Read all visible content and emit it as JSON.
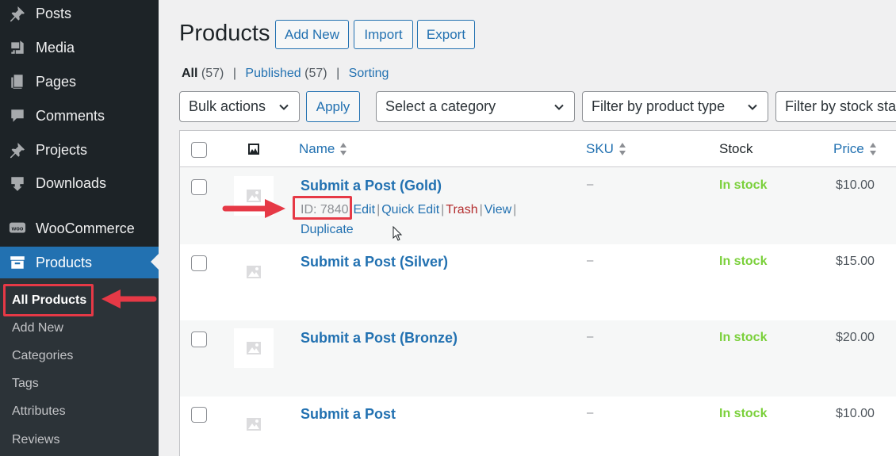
{
  "sidebar": {
    "items": [
      {
        "label": "Posts",
        "icon": "pin-icon"
      },
      {
        "label": "Media",
        "icon": "media-icon"
      },
      {
        "label": "Pages",
        "icon": "pages-icon"
      },
      {
        "label": "Comments",
        "icon": "comment-icon"
      },
      {
        "label": "Projects",
        "icon": "pin-icon"
      },
      {
        "label": "Downloads",
        "icon": "download-icon"
      },
      {
        "label": "WooCommerce",
        "icon": "woo-icon"
      },
      {
        "label": "Products",
        "icon": "archive-icon",
        "current": true
      }
    ],
    "submenu": [
      "All Products",
      "Add New",
      "Categories",
      "Tags",
      "Attributes",
      "Reviews"
    ],
    "woo_badge": "woo"
  },
  "header": {
    "title": "Products",
    "buttons": [
      "Add New",
      "Import",
      "Export"
    ]
  },
  "views": {
    "all_label": "All",
    "all_count": "(57)",
    "published_label": "Published",
    "published_count": "(57)",
    "sorting_label": "Sorting",
    "separator": "|"
  },
  "filters": {
    "bulk_actions": "Bulk actions",
    "apply": "Apply",
    "category": "Select a category",
    "product_type": "Filter by product type",
    "stock_status": "Filter by stock status"
  },
  "table": {
    "columns": {
      "name": "Name",
      "sku": "SKU",
      "stock": "Stock",
      "price": "Price"
    },
    "rows": [
      {
        "name": "Submit a Post (Gold)",
        "sku": "–",
        "stock": "In stock",
        "price": "$10.00"
      },
      {
        "name": "Submit a Post (Silver)",
        "sku": "–",
        "stock": "In stock",
        "price": "$15.00"
      },
      {
        "name": "Submit a Post (Bronze)",
        "sku": "–",
        "stock": "In stock",
        "price": "$20.00"
      },
      {
        "name": "Submit a Post",
        "sku": "–",
        "stock": "In stock",
        "price": "$10.00"
      }
    ],
    "row_actions": {
      "id": "ID: 7840",
      "edit": "Edit",
      "quick_edit": "Quick Edit",
      "trash": "Trash",
      "view": "View",
      "duplicate": "Duplicate",
      "separator": "|"
    }
  },
  "colors": {
    "sidebar_bg": "#1d2327",
    "accent": "#2271b1",
    "highlight": "#e63946",
    "in_stock": "#7ad03a",
    "trash": "#b32d2e"
  }
}
